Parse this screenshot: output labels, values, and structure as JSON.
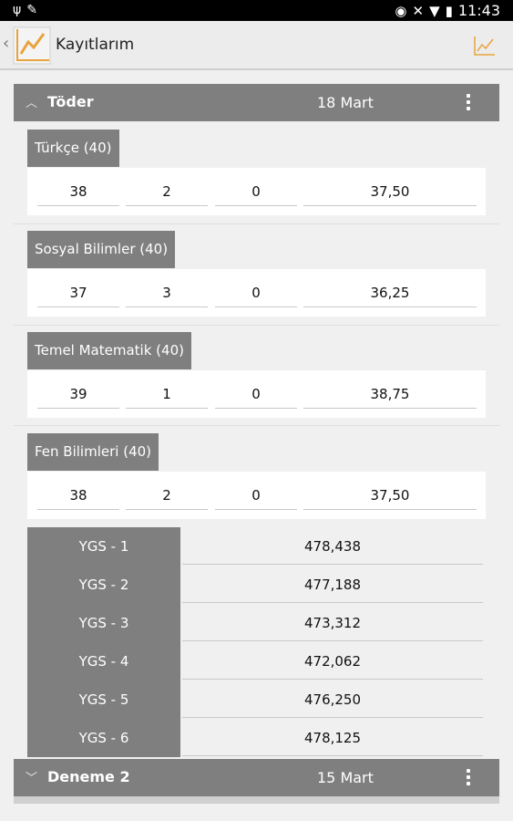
{
  "status_bar": {
    "time": "11:43"
  },
  "action_bar": {
    "title": "Kayıtlarım"
  },
  "records": [
    {
      "name": "Töder",
      "date": "18 Mart",
      "expanded": true,
      "subjects": [
        {
          "label": "Türkçe (40)",
          "correct": "38",
          "wrong": "2",
          "empty": "0",
          "net": "37,50"
        },
        {
          "label": "Sosyal Bilimler (40)",
          "correct": "37",
          "wrong": "3",
          "empty": "0",
          "net": "36,25"
        },
        {
          "label": "Temel Matematik (40)",
          "correct": "39",
          "wrong": "1",
          "empty": "0",
          "net": "38,75"
        },
        {
          "label": "Fen Bilimleri (40)",
          "correct": "38",
          "wrong": "2",
          "empty": "0",
          "net": "37,50"
        }
      ],
      "ygs": [
        {
          "label": "YGS - 1",
          "value": "478,438"
        },
        {
          "label": "YGS - 2",
          "value": "477,188"
        },
        {
          "label": "YGS - 3",
          "value": "473,312"
        },
        {
          "label": "YGS - 4",
          "value": "472,062"
        },
        {
          "label": "YGS - 5",
          "value": "476,250"
        },
        {
          "label": "YGS - 6",
          "value": "478,125"
        }
      ]
    },
    {
      "name": "Deneme 2",
      "date": "15 Mart",
      "expanded": false
    }
  ],
  "colors": {
    "header_bg": "#7f7f7f",
    "accent": "#e8a33c",
    "page_bg": "#f0f0f0"
  },
  "icons": [
    "usb-icon",
    "pencil-icon",
    "eye-icon",
    "mute-icon",
    "wifi-icon",
    "battery-icon",
    "back-icon",
    "app-logo-icon",
    "line-chart-icon",
    "overflow-menu-icon",
    "chevron-up-icon",
    "chevron-down-icon"
  ]
}
